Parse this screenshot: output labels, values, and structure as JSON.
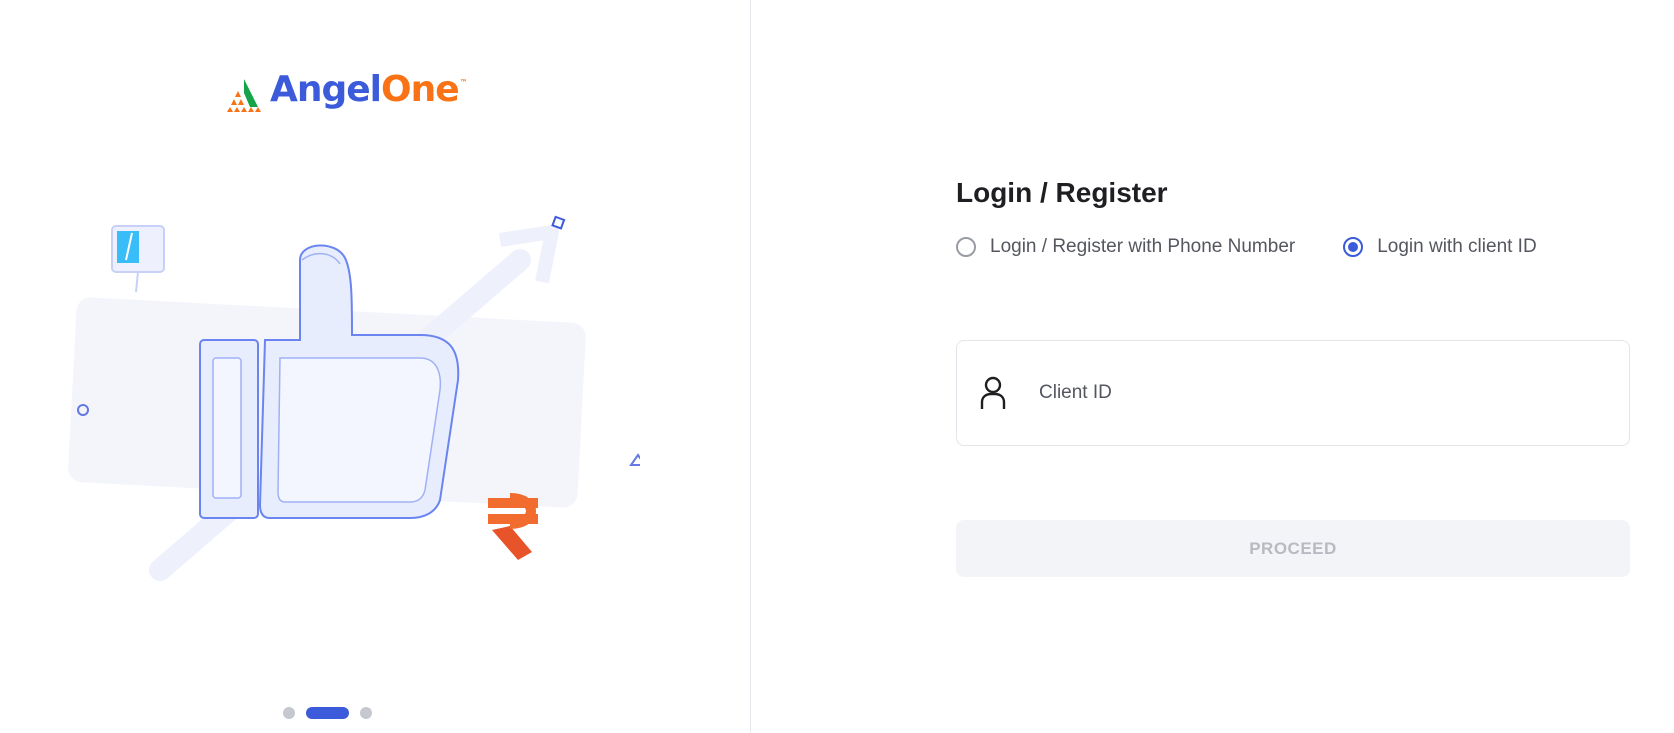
{
  "brand": {
    "name_part1": "Angel",
    "name_part2": "One",
    "trademark": "™"
  },
  "illustration": {
    "icon": "thumbs-up-rupee-illustration"
  },
  "carousel": {
    "count": 3,
    "active_index": 1
  },
  "login": {
    "heading": "Login / Register",
    "options": [
      {
        "label": "Login / Register with Phone Number",
        "selected": false
      },
      {
        "label": "Login with client ID",
        "selected": true
      }
    ],
    "client_id": {
      "icon": "user-icon",
      "placeholder": "Client ID",
      "value": ""
    },
    "proceed_label": "PROCEED"
  },
  "colors": {
    "brand_blue": "#3b5bdb",
    "brand_orange": "#f97316",
    "disabled_button_bg": "#f3f4f7",
    "disabled_button_text": "#b8bac2"
  }
}
